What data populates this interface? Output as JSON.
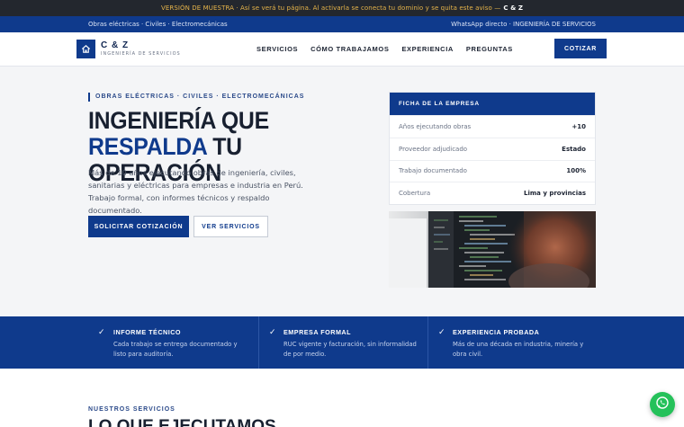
{
  "demo_bar": {
    "text": "VERSIÓN DE MUESTRA · Así se verá tu página. Al activarla se conecta tu dominio y se quita este aviso —",
    "brand": "C & Z"
  },
  "util_bar": {
    "left": "Obras eléctricas · Civiles · Electromecánicas",
    "right": "WhatsApp directo · INGENIERÍA DE SERVICIOS"
  },
  "header": {
    "logo_name": "C & Z",
    "logo_sub": "INGENIERÍA DE SERVICIOS",
    "menu": [
      "SERVICIOS",
      "CÓMO TRABAJAMOS",
      "EXPERIENCIA",
      "PREGUNTAS"
    ],
    "cta_label": "COTIZAR"
  },
  "hero": {
    "eyebrow": "OBRAS ELÉCTRICAS · CIVILES · ELECTROMECÁNICAS",
    "title_part1": "INGENIERÍA QUE ",
    "title_highlight": "RESPALDA",
    "title_part2": " TU OPERACIÓN",
    "lead": "Más de 10 años ejecutando obras de ingeniería, civiles, sanitarias y eléctricas para empresas e industria en Perú. Trabajo formal, con informes técnicos y respaldo documentado.",
    "primary_button": "SOLICITAR COTIZACIÓN",
    "secondary_button": "VER SERVICIOS"
  },
  "company_card": {
    "title": "FICHA DE LA EMPRESA",
    "rows": [
      {
        "label": "Años ejecutando obras",
        "value": "+10"
      },
      {
        "label": "Proveedor adjudicado",
        "value": "Estado"
      },
      {
        "label": "Trabajo documentado",
        "value": "100%"
      },
      {
        "label": "Cobertura",
        "value": "Lima y provincias"
      }
    ]
  },
  "features": [
    {
      "title": "INFORME TÉCNICO",
      "text": "Cada trabajo se entrega documentado y listo para auditoría."
    },
    {
      "title": "EMPRESA FORMAL",
      "text": "RUC vigente y facturación, sin informalidad de por medio."
    },
    {
      "title": "EXPERIENCIA PROBADA",
      "text": "Más de una década en industria, minería y obra civil."
    }
  ],
  "services": {
    "eyebrow": "NUESTROS SERVICIOS",
    "title": "LO QUE EJECUTAMOS"
  },
  "icons": {
    "logo": "home-icon",
    "feature": "check-icon",
    "floating": "whatsapp-icon"
  },
  "colors": {
    "primary": "#0f3a8c",
    "demo_bar": "#23272e",
    "demo_text": "#e6b44a",
    "whatsapp": "#25c15a"
  }
}
